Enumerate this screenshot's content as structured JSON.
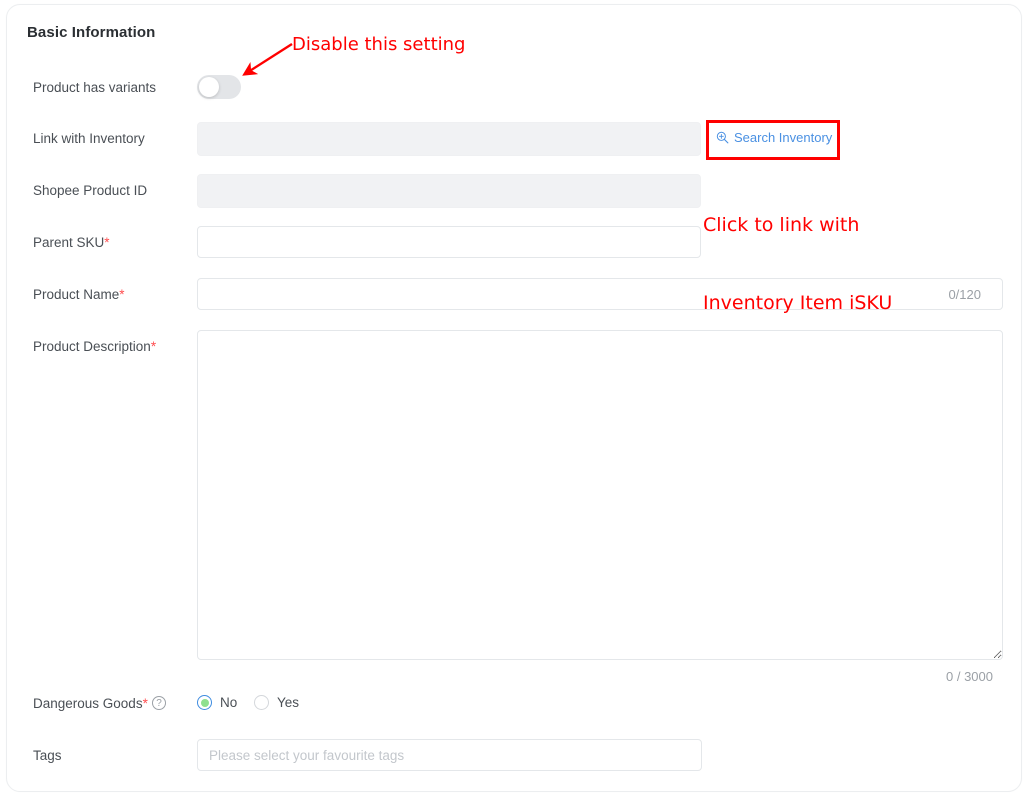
{
  "section": {
    "title": "Basic Information"
  },
  "rows": {
    "variants": {
      "label": "Product has variants",
      "toggle_state": "off"
    },
    "link_inventory": {
      "label": "Link with Inventory",
      "value": "",
      "disabled": true
    },
    "shopee_product_id": {
      "label": "Shopee Product ID",
      "value": "",
      "disabled": true
    },
    "parent_sku": {
      "label": "Parent SKU",
      "required_mark": "*",
      "value": "",
      "placeholder": ""
    },
    "product_name": {
      "label": "Product Name",
      "required_mark": "*",
      "value": "",
      "placeholder": "",
      "counter": "0/120"
    },
    "product_description": {
      "label": "Product Description",
      "required_mark": "*",
      "value": "",
      "placeholder": "",
      "counter": "0 / 3000"
    },
    "dangerous_goods": {
      "label": "Dangerous Goods",
      "required_mark": "*",
      "help_icon": "question-circle-icon",
      "help_glyph": "?",
      "options": [
        {
          "label": "No",
          "selected": true
        },
        {
          "label": "Yes",
          "selected": false
        }
      ]
    },
    "tags": {
      "label": "Tags",
      "value": "",
      "placeholder": "Please select your favourite tags"
    }
  },
  "search_inventory": {
    "label": "Search Inventory",
    "icon": "zoom-in-icon",
    "color": "#4a90e2"
  },
  "annotations": {
    "disable_setting": "Disable this setting",
    "click_to_link_line1": "Click to link with",
    "click_to_link_line2": "Inventory Item iSKU",
    "color": "#ff0000"
  }
}
